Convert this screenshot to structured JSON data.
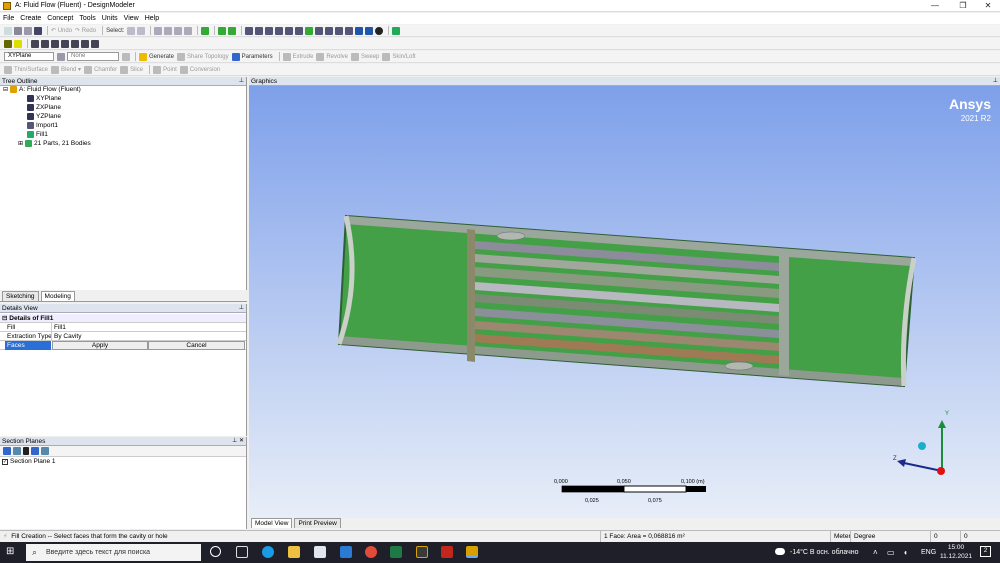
{
  "window": {
    "title": "A: Fluid Flow (Fluent) - DesignModeler"
  },
  "menu": [
    "File",
    "Create",
    "Concept",
    "Tools",
    "Units",
    "View",
    "Help"
  ],
  "toolbar1": {
    "undo": "Undo",
    "redo": "Redo",
    "select": "Select:"
  },
  "toolbar3": {
    "plane": "XYPlane",
    "sketch": "None",
    "generate": "Generate",
    "share_topology": "Share Topology",
    "parameters": "Parameters",
    "extrude": "Extrude",
    "revolve": "Revolve",
    "sweep": "Sweep",
    "skin_loft": "Skin/Loft"
  },
  "toolbar4": {
    "thin_surface": "Thin/Surface",
    "blend": "Blend",
    "chamfer": "Chamfer",
    "slice": "Slice",
    "point": "Point",
    "conversion": "Conversion"
  },
  "tree": {
    "header": "Tree Outline",
    "root": "A: Fluid Flow (Fluent)",
    "items": [
      "XYPlane",
      "ZXPlane",
      "YZPlane",
      "Import1",
      "Fill1",
      "21 Parts, 21 Bodies"
    ]
  },
  "tabs": [
    "Sketching",
    "Modeling"
  ],
  "details": {
    "header": "Details View",
    "group": "Details of Fill1",
    "rows": [
      {
        "k": "Fill",
        "v": "Fill1"
      },
      {
        "k": "Extraction Type",
        "v": "By Cavity"
      }
    ],
    "faces_label": "Faces",
    "apply": "Apply",
    "cancel": "Cancel"
  },
  "section_planes": {
    "header": "Section Planes",
    "item": "Section Plane 1"
  },
  "graphics": {
    "header": "Graphics",
    "brand": "Ansys",
    "version": "2021 R2",
    "scale": {
      "top": [
        "0,000",
        "0,050",
        "0,100 (m)"
      ],
      "bottom": [
        "0,025",
        "0,075"
      ]
    },
    "axes": {
      "x": "Z",
      "y": "Y"
    },
    "tabs": [
      "Model View",
      "Print Preview"
    ]
  },
  "status": {
    "message": "Fill Creation -- Select faces that form the cavity or hole",
    "area": "1 Face: Area = 0,068816 m²",
    "units": "Meter",
    "angle": "Degree",
    "v1": "0",
    "v2": "0"
  },
  "taskbar": {
    "search": "Введите здесь текст для поиска",
    "weather": "-14°C  В осн. облачно",
    "lang": "ENG",
    "time": "15:00",
    "date": "11.12.2021",
    "notif": "2"
  }
}
